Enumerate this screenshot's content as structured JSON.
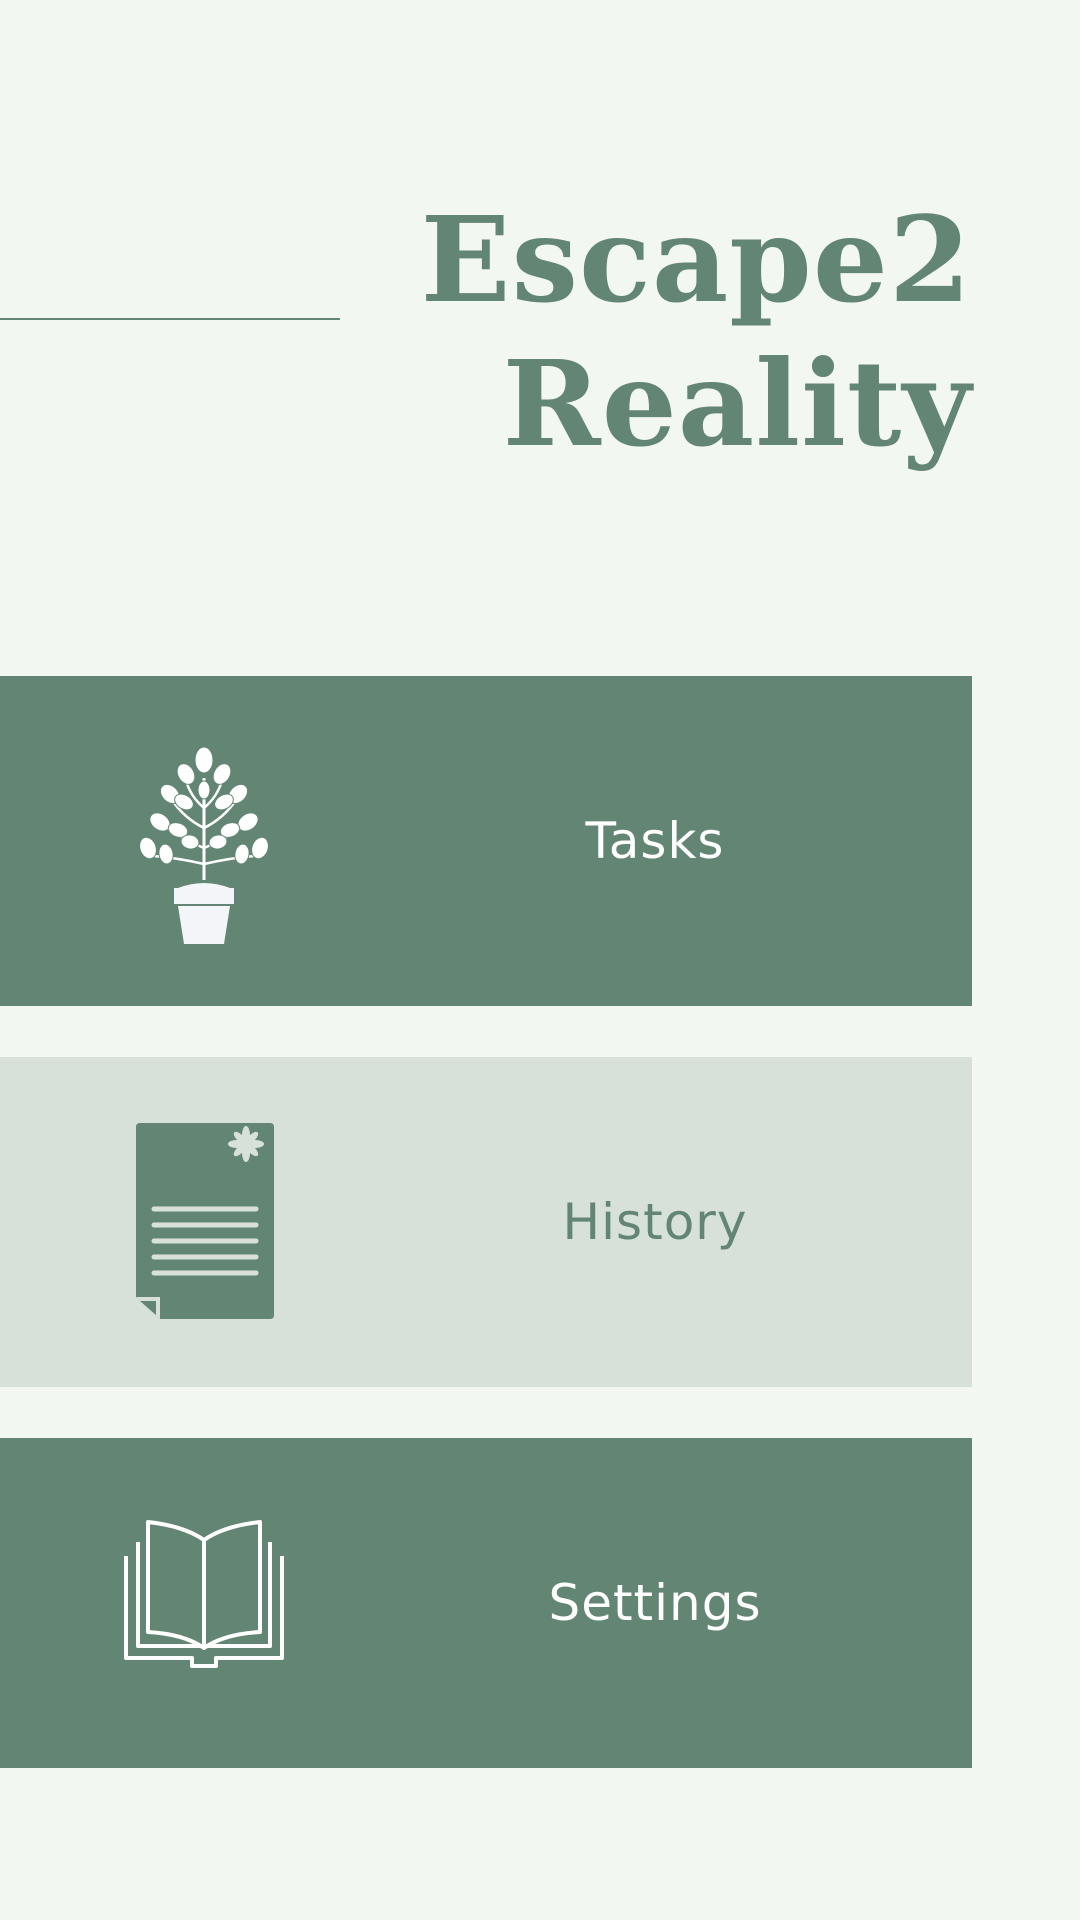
{
  "app": {
    "title_line1": "Escape2",
    "title_line2": "Reality"
  },
  "colors": {
    "background": "#f2f7f2",
    "primary": "#638674",
    "secondary": "#d7e1d9",
    "on_primary": "#ffffff"
  },
  "menu": {
    "items": [
      {
        "label": "Tasks",
        "icon": "potted-plant-icon"
      },
      {
        "label": "History",
        "icon": "document-icon"
      },
      {
        "label": "Settings",
        "icon": "open-book-icon"
      }
    ]
  }
}
